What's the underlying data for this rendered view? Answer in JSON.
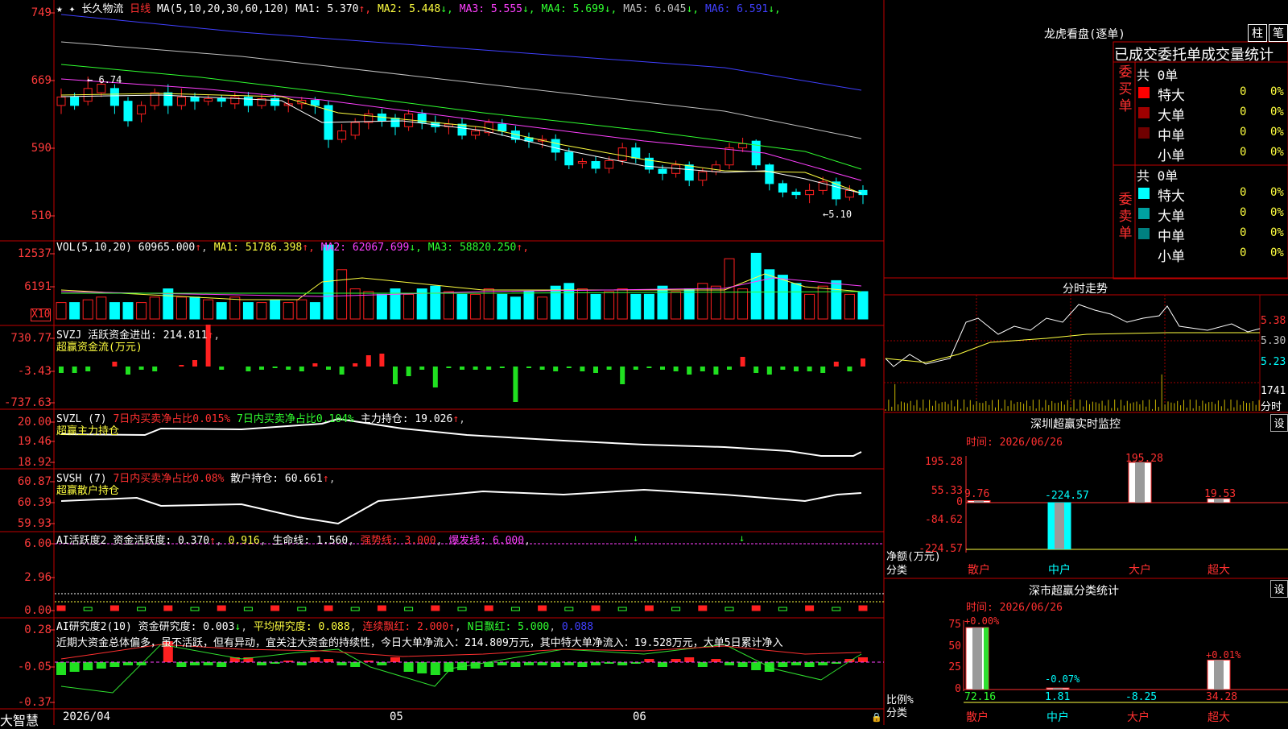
{
  "colors": {
    "up": "#ff2020",
    "down": "#00ffff",
    "bg": "#000000",
    "frame": "#c00000",
    "axis": "#ff3b3b",
    "white": "#ffffff",
    "yellow": "#ffff40",
    "magenta": "#ff40ff",
    "green": "#30ff30",
    "blue": "#4040ff",
    "gray": "#c0c0c0"
  },
  "price_panel": {
    "axis_labels": [
      "749",
      "669",
      "590",
      "510"
    ],
    "stock_name": "长久物流",
    "period": "日线",
    "ma_params": "MA(5,10,20,30,60,120)",
    "ma": [
      {
        "label": "MA1: 5.370",
        "arrow": "↑",
        "color": "#ffffff"
      },
      {
        "label": "MA2: 5.448",
        "arrow": "↓",
        "color": "#ffff40"
      },
      {
        "label": "MA3: 5.555",
        "arrow": "↓",
        "color": "#ff40ff"
      },
      {
        "label": "MA4: 5.699",
        "arrow": "↓",
        "color": "#30ff30"
      },
      {
        "label": "MA5: 6.045",
        "arrow": "↓",
        "color": "#c0c0c0"
      },
      {
        "label": "MA6: 6.591",
        "arrow": "↓",
        "color": "#4040ff"
      }
    ],
    "high_label": "← 6.74",
    "low_label": "←5.10",
    "top_icons": "★ ✦"
  },
  "vol_panel": {
    "axis_labels": [
      "12537",
      "6191",
      "X10"
    ],
    "title": "VOL(5,10,20)",
    "value": "60965.000",
    "arrow": "↑",
    "ma": [
      {
        "label": "MA1: 51786.398",
        "arrow": "↑",
        "color": "#ffff40"
      },
      {
        "label": "MA2: 62067.699",
        "arrow": "↓",
        "color": "#ff40ff"
      },
      {
        "label": "MA3: 58820.250",
        "arrow": "↑",
        "color": "#30ff30"
      }
    ]
  },
  "svzj_panel": {
    "axis_labels": [
      "730.77",
      "-3.43",
      "-737.63"
    ],
    "title": "SVZJ 活跃资金进出: 214.811",
    "arrow": "↑",
    "sub": "超赢资金流(万元)"
  },
  "svzl_panel": {
    "axis_labels": [
      "20.00",
      "19.46",
      "18.92"
    ],
    "title": "SVZL (7)",
    "a": "7日内买卖净占比0.015%",
    "b": "7日内买卖净占比0.104%",
    "c": "主力持仓: 19.026",
    "arrow": "↑",
    "sub": "超赢主力持仓"
  },
  "svsh_panel": {
    "axis_labels": [
      "60.87",
      "60.39",
      "59.93"
    ],
    "title": "SVSH (7)",
    "a": "7日内买卖净占比0.08%",
    "c": "散户持仓: 60.661",
    "arrow": "↑",
    "sub": "超赢散户持仓"
  },
  "ai1_panel": {
    "axis_labels": [
      "6.00",
      "2.96",
      "0.00"
    ],
    "title": "AI活跃度2",
    "a": "资金活跃度: 0.370",
    "b": "0.916",
    "c": "生命线: 1.560",
    "d": "强势线: 3.000",
    "e": "爆发线: 6.000"
  },
  "ai2_panel": {
    "axis_labels": [
      "0.28",
      "-0.05",
      "-0.37"
    ],
    "title": "AI研究度2(10)",
    "a": "资金研究度: 0.003",
    "b": "平均研究度: 0.088",
    "c": "连续飘红: 2.000",
    "d": "N日飘红: 5.000",
    "e": "0.088",
    "note": "近期大资金总体偏多，虽不活跃，但有异动，宜关注大资金的持续性，今日大单净流入：214.809万元，其中特大单净流入：19.528万元，大单5日累计净入"
  },
  "date_axis": [
    "2026/04",
    "05",
    "06"
  ],
  "brand": "大智慧",
  "right": {
    "lhkp_title": "龙虎看盘(逐单)",
    "lhkp_btns": [
      "柱",
      "笔"
    ],
    "table_title": "已成交委托单成交量统计",
    "buy": {
      "side": "委买单",
      "total": "共 0单",
      "rows": [
        {
          "name": "特大",
          "v": "0",
          "p": "0%",
          "c": "#ff0000"
        },
        {
          "name": "大单",
          "v": "0",
          "p": "0%",
          "c": "#a00000"
        },
        {
          "name": "中单",
          "v": "0",
          "p": "0%",
          "c": "#700000"
        },
        {
          "name": "小单",
          "v": "0",
          "p": "0%",
          "c": "#000000"
        }
      ]
    },
    "sell": {
      "side": "委卖单",
      "total": "共 0单",
      "rows": [
        {
          "name": "特大",
          "v": "0",
          "p": "0%",
          "c": "#00ffff"
        },
        {
          "name": "大单",
          "v": "0",
          "p": "0%",
          "c": "#00a0a0"
        },
        {
          "name": "中单",
          "v": "0",
          "p": "0%",
          "c": "#008080"
        },
        {
          "name": "小单",
          "v": "0",
          "p": "0%",
          "c": "#000000"
        }
      ]
    },
    "fenshi": {
      "title": "分时走势",
      "prices": [
        "5.38",
        "5.30",
        "5.23"
      ],
      "vol": "1741",
      "vol_unit": "分时"
    },
    "sz": {
      "title": "深圳超赢实时监控",
      "btn": "设",
      "time": "时间: 2026/06/26",
      "axis": [
        "195.28",
        "55.33",
        "0",
        "-84.62",
        "-224.57"
      ],
      "ylabel1": "净额(万元)",
      "ylabel2": "分类",
      "cats": [
        "散户",
        "中户",
        "大户",
        "超大"
      ],
      "vals": [
        "9.76",
        "-224.57",
        "195.28",
        "19.53"
      ],
      "values": [
        9.76,
        -224.57,
        195.28,
        19.53
      ]
    },
    "ss": {
      "title": "深市超赢分类统计",
      "btn": "设",
      "time": "时间: 2026/06/26",
      "axis": [
        "75",
        "50",
        "25",
        "0"
      ],
      "ylabel1": "比例%",
      "ylabel2": "分类",
      "cats": [
        "散户",
        "中户",
        "大户",
        "超大"
      ],
      "pct": [
        "72.16",
        "1.81",
        "-8.25",
        "34.28"
      ],
      "top": [
        "+0.00%",
        "-0.07%",
        "",
        "+0.01%"
      ],
      "values": [
        72.16,
        1.81,
        -8.25,
        34.28
      ]
    }
  }
}
